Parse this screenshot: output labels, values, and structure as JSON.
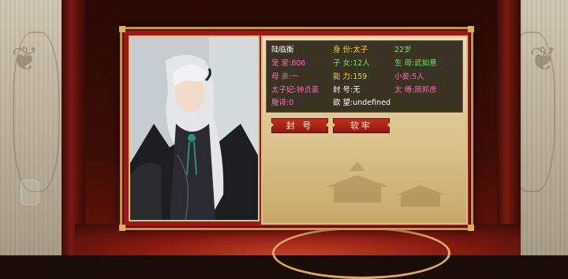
{
  "character": {
    "name": "陆临衡",
    "identity": "身 份:太子",
    "age": "22岁",
    "favor": "宠 爱:806",
    "children": "子 女:12人",
    "birth_mother": "生 母:武如意",
    "mother": "母 亲:一",
    "ability": "能 力:159",
    "concubines": "小妾:5人",
    "crown_princess": "太子妃:钟贞素",
    "title": "封 号:无",
    "tutor": "太 傅:周邦彦",
    "resent": "腹诽:0",
    "desire": "欲 望:undefined"
  },
  "buttons": {
    "confer_title": "封 号",
    "imprison": "软牢"
  },
  "colors": {
    "white_text": "#ffffff",
    "yellow_text": "#f2d21e",
    "green_text": "#6ee06a",
    "pink_text": "#f06fb0",
    "panel_red": "#9c1a12",
    "gold_border": "#c8953d"
  }
}
